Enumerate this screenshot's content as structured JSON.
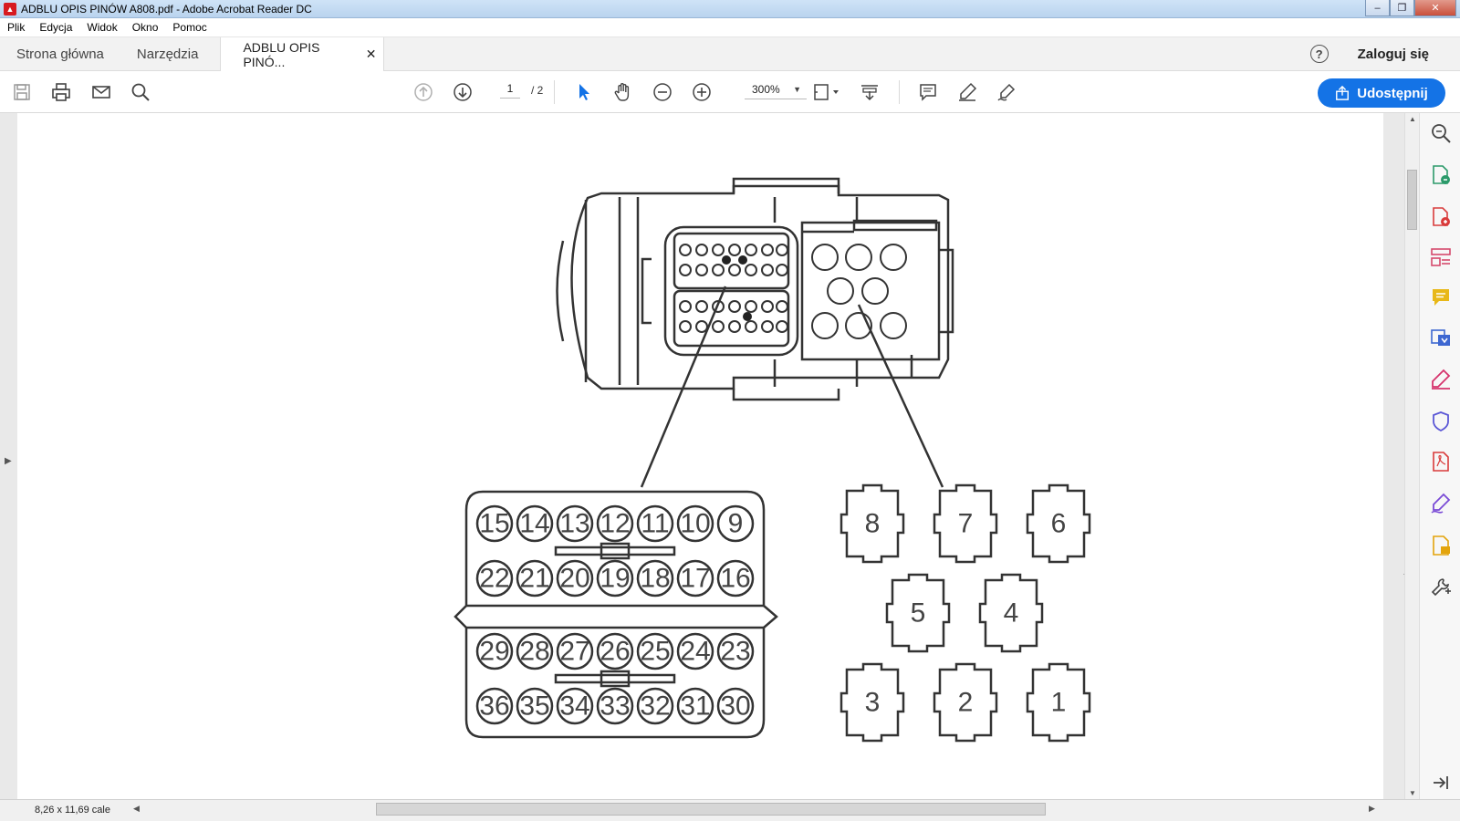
{
  "window": {
    "title": "ADBLU OPIS PINÓW A808.pdf - Adobe Acrobat Reader DC"
  },
  "menu": [
    "Plik",
    "Edycja",
    "Widok",
    "Okno",
    "Pomoc"
  ],
  "tabs": {
    "home": "Strona główna",
    "tools": "Narzędzia",
    "document": "ADBLU OPIS PINÓ...",
    "login": "Zaloguj się"
  },
  "toolbar": {
    "page_current": "1",
    "page_total": "/ 2",
    "zoom": "300%",
    "share_label": "Udostępnij"
  },
  "status": {
    "page_size": "8,26 x 11,69 cale"
  },
  "document": {
    "connector_a": {
      "rows": [
        [
          "15",
          "14",
          "13",
          "12",
          "11",
          "10",
          "9"
        ],
        [
          "22",
          "21",
          "20",
          "19",
          "18",
          "17",
          "16"
        ],
        [
          "29",
          "28",
          "27",
          "26",
          "25",
          "24",
          "23"
        ],
        [
          "36",
          "35",
          "34",
          "33",
          "32",
          "31",
          "30"
        ]
      ]
    },
    "connector_b": {
      "rows": [
        [
          "8",
          "7",
          "6"
        ],
        [
          "5",
          "4"
        ],
        [
          "3",
          "2",
          "1"
        ]
      ]
    }
  },
  "icons": {
    "toolbar": [
      "save-icon",
      "print-icon",
      "email-icon",
      "search-icon",
      "prev-page-icon",
      "next-page-icon",
      "select-tool-icon",
      "hand-tool-icon",
      "zoom-out-icon",
      "zoom-in-icon",
      "page-fit-icon",
      "scroll-mode-icon",
      "comment-icon",
      "highlight-icon",
      "sign-icon",
      "share-icon"
    ],
    "right_pane": [
      "enhance-scan-icon",
      "export-pdf-icon",
      "create-pdf-icon",
      "organize-pages-icon",
      "comment-icon",
      "edit-pdf-icon",
      "fill-sign-icon",
      "protect-icon",
      "pdf-icon",
      "sign-request-icon",
      "send-comments-icon",
      "more-tools-icon"
    ]
  },
  "colors": {
    "accent": "#1473e6",
    "close_button": "#c9503c"
  }
}
